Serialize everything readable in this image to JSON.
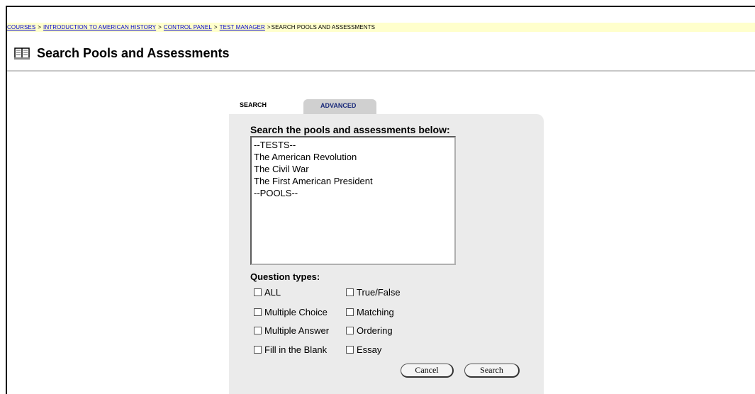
{
  "breadcrumb": {
    "items": [
      "COURSES",
      "INTRODUCTION TO AMERICAN HISTORY",
      "CONTROL PANEL",
      "TEST MANAGER"
    ],
    "separator": ">",
    "current": "SEARCH POOLS AND ASSESSMENTS"
  },
  "header": {
    "title": "Search Pools and Assessments",
    "icon": "book-icon"
  },
  "tabs": {
    "search": "SEARCH",
    "advanced": "ADVANCED"
  },
  "search": {
    "label": "Search the pools and assessments below:",
    "options": [
      "--TESTS--",
      "The American Revolution",
      "The Civil War",
      "The First American President",
      "--POOLS--"
    ]
  },
  "question_types": {
    "label": "Question types:",
    "all": "ALL",
    "true_false": "True/False",
    "multiple_choice": "Multiple Choice",
    "matching": "Matching",
    "multiple_answer": "Multiple Answer",
    "ordering": "Ordering",
    "fill_blank": "Fill in the Blank",
    "essay": "Essay"
  },
  "buttons": {
    "cancel": "Cancel",
    "search": "Search"
  }
}
